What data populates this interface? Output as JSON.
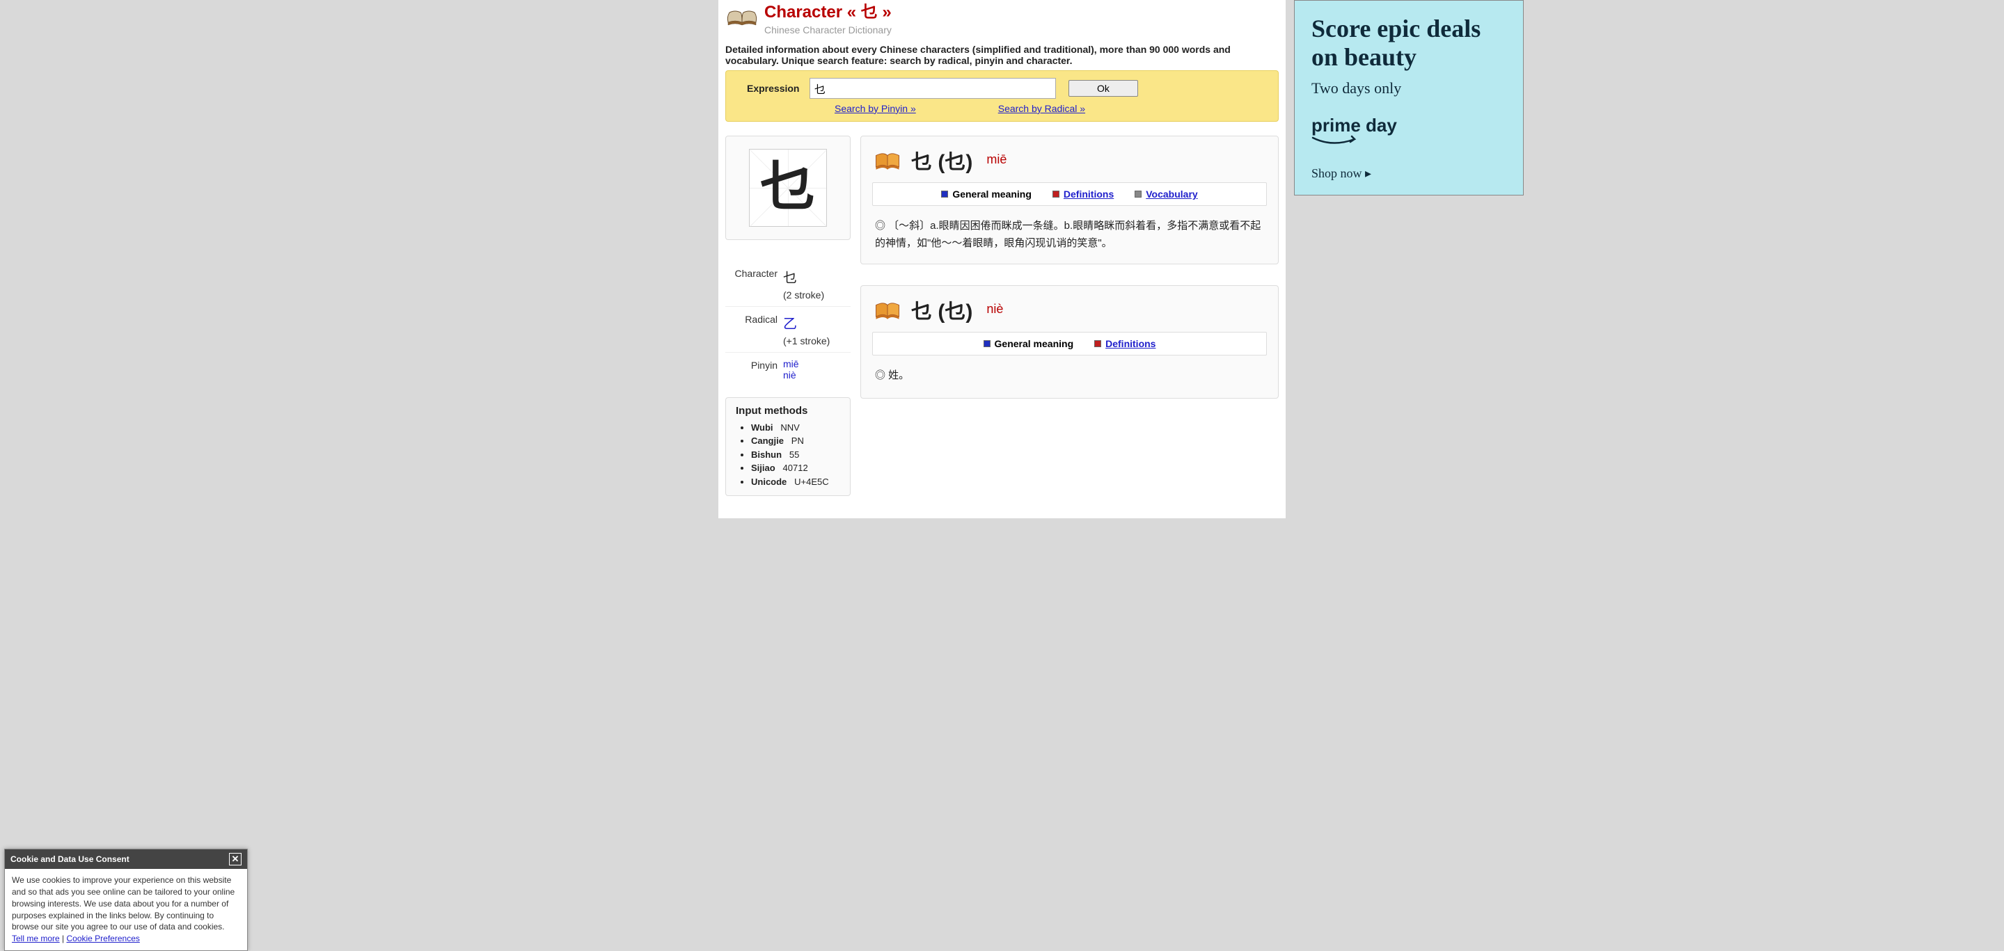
{
  "header": {
    "title": "Character « 乜 »",
    "subtitle": "Chinese Character Dictionary"
  },
  "intro": "Detailed information about every Chinese characters (simplified and traditional), more than 90 000 words and vocabulary. Unique search feature: search by radical, pinyin and character.",
  "search": {
    "label": "Expression",
    "value": "乜",
    "button": "Ok",
    "link_pinyin": "Search by Pinyin »",
    "link_radical": "Search by Radical »"
  },
  "char_panel": {
    "character": "乜",
    "info": {
      "character_label": "Character",
      "character_value": "乜",
      "character_strokes": "(2 stroke)",
      "radical_label": "Radical",
      "radical_value": "乙",
      "radical_strokes": "(+1 stroke)",
      "pinyin_label": "Pinyin",
      "pinyin_1": "miē",
      "pinyin_2": "niè"
    }
  },
  "input_methods": {
    "title": "Input methods",
    "items": [
      {
        "label": "Wubi",
        "value": "NNV"
      },
      {
        "label": "Cangjie",
        "value": "PN"
      },
      {
        "label": "Bishun",
        "value": "55"
      },
      {
        "label": "Sijiao",
        "value": "40712"
      },
      {
        "label": "Unicode",
        "value": "U+4E5C"
      }
    ]
  },
  "entries": [
    {
      "hanzi": "乜 (乜)",
      "pinyin": "miē",
      "tabs": {
        "general": "General meaning",
        "definitions": "Definitions",
        "vocabulary": "Vocabulary"
      },
      "body": "◎ 〔～斜〕a.眼睛因困倦而眯成一条缝。b.眼睛略眯而斜着看，多指不满意或看不起的神情，如\"他～～着眼睛，眼角闪现讥诮的笑意\"。"
    },
    {
      "hanzi": "乜 (乜)",
      "pinyin": "niè",
      "tabs": {
        "general": "General meaning",
        "definitions": "Definitions"
      },
      "body": "◎ 姓。"
    }
  ],
  "ad": {
    "headline": "Score epic deals on beauty",
    "sub": "Two days only",
    "brand": "prime day",
    "cta": "Shop now ▸"
  },
  "cookie": {
    "title": "Cookie and Data Use Consent",
    "body": "We use cookies to improve your experience on this website and so that ads you see online can be tailored to your online browsing interests. We use data about you for a number of purposes explained in the links below. By continuing to browse our site you agree to our use of data and cookies.",
    "link1": "Tell me more",
    "sep": " | ",
    "link2": "Cookie Preferences"
  }
}
